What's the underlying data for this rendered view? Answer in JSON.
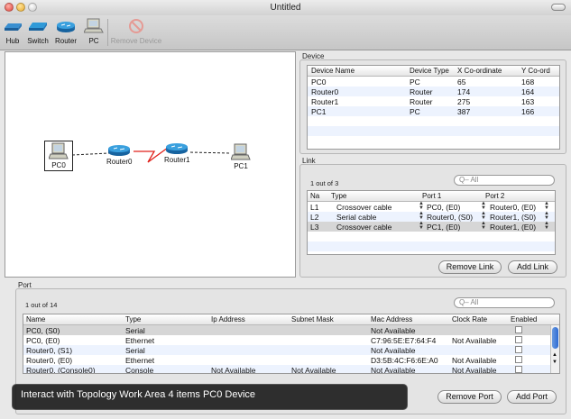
{
  "window": {
    "title": "Untitled"
  },
  "toolbar": {
    "hub": "Hub",
    "switch": "Switch",
    "router": "Router",
    "pc": "PC",
    "remove_device": "Remove Device"
  },
  "topology": {
    "devices": [
      {
        "label": "PC0",
        "selected": true
      },
      {
        "label": "Router0"
      },
      {
        "label": "Router1"
      },
      {
        "label": "PC1"
      }
    ]
  },
  "device_section": {
    "label": "Device",
    "columns": [
      "Device Name",
      "Device Type",
      "X Co-ordinate",
      "Y Co-ord"
    ],
    "rows": [
      [
        "PC0",
        "PC",
        "65",
        "168"
      ],
      [
        "Router0",
        "Router",
        "174",
        "164"
      ],
      [
        "Router1",
        "Router",
        "275",
        "163"
      ],
      [
        "PC1",
        "PC",
        "387",
        "166"
      ]
    ]
  },
  "link_section": {
    "label": "Link",
    "count": "1 out of 3",
    "search_placeholder": "Q– All",
    "columns": [
      "Na",
      "Type",
      "Port 1",
      "Port 2"
    ],
    "rows": [
      [
        "L1",
        "Crossover cable",
        "PC0, (E0)",
        "Router0, (E0)"
      ],
      [
        "L2",
        "Serial cable",
        "Router0, (S0)",
        "Router1, (S0)"
      ],
      [
        "L3",
        "Crossover cable",
        "PC1, (E0)",
        "Router1, (E0)"
      ]
    ],
    "remove_button": "Remove Link",
    "add_button": "Add Link"
  },
  "port_section": {
    "label": "Port",
    "count": "1 out of 14",
    "search_placeholder": "Q– All",
    "columns": [
      "Name",
      "Type",
      "Ip Address",
      "Subnet Mask",
      "Mac Address",
      "Clock Rate",
      "Enabled"
    ],
    "rows": [
      [
        "PC0, (S0)",
        "Serial",
        "",
        "",
        "Not Available",
        "",
        ""
      ],
      [
        "PC0, (E0)",
        "Ethernet",
        "",
        "",
        "C7:96:5E:E7:64:F4",
        "Not Available",
        ""
      ],
      [
        "Router0, (S1)",
        "Serial",
        "",
        "",
        "Not Available",
        "",
        ""
      ],
      [
        "Router0, (E0)",
        "Ethernet",
        "",
        "",
        "D3:5B:4C:F6:6E:A0",
        "Not Available",
        ""
      ],
      [
        "Router0, (Console0)",
        "Console",
        "Not Available",
        "Not Available",
        "Not Available",
        "Not Available",
        ""
      ]
    ],
    "remove_button": "Remove Port",
    "add_button": "Add Port"
  },
  "hud": {
    "text": "Interact with  Topology Work Area  4 items PC0 Device"
  },
  "colors": {
    "serial_link": "#e0201a",
    "router": "#2f8fc9",
    "selection_row": "#d6d6d6",
    "alt_row": "#edf3fe"
  }
}
